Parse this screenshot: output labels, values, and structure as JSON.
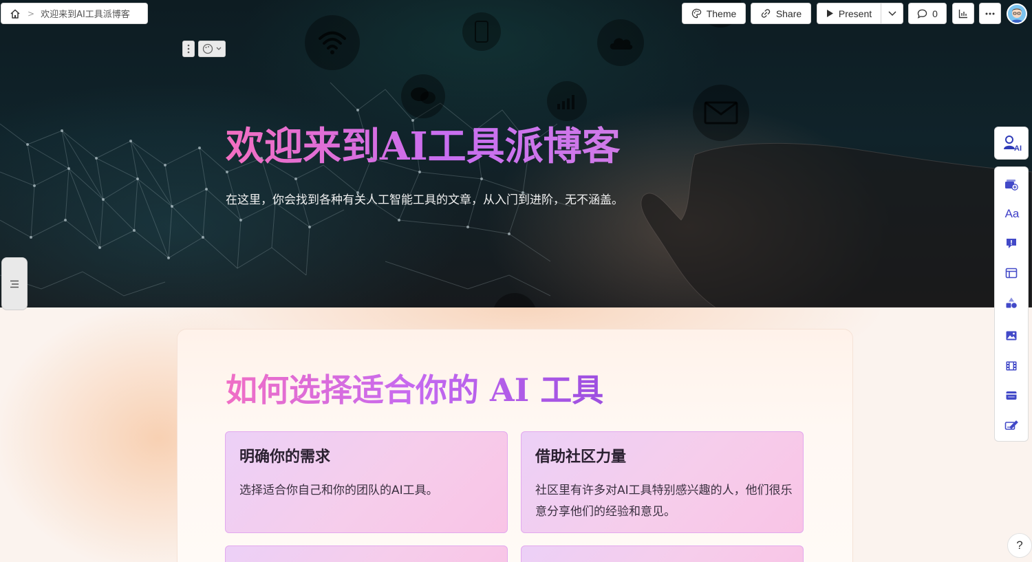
{
  "breadcrumb": {
    "title": "欢迎来到AI工具派博客",
    "home_icon": "home-icon"
  },
  "toolbar": {
    "theme_label": "Theme",
    "share_label": "Share",
    "present_label": "Present",
    "comments_count": "0"
  },
  "hero": {
    "title": "欢迎来到AI工具派博客",
    "subtitle": "在这里，你会找到各种有关人工智能工具的文章，从入门到进阶，无不涵盖。"
  },
  "section": {
    "title": "如何选择适合你的 AI 工具",
    "cards": [
      {
        "title": "明确你的需求",
        "body": "选择适合你自己和你的团队的AI工具。"
      },
      {
        "title": "借助社区力量",
        "body": "社区里有许多对AI工具特别感兴趣的人，他们很乐意分享他们的经验和意见。"
      }
    ]
  },
  "side_panel": {
    "ai_label": "AI",
    "text_style_label": "Aa"
  },
  "help": {
    "label": "?"
  },
  "colors": {
    "accent_pink": "#f36fc1",
    "accent_purple": "#c56af0",
    "card_bg": "#f6cdeb",
    "tool_icon_blue": "#3f3fc8"
  }
}
